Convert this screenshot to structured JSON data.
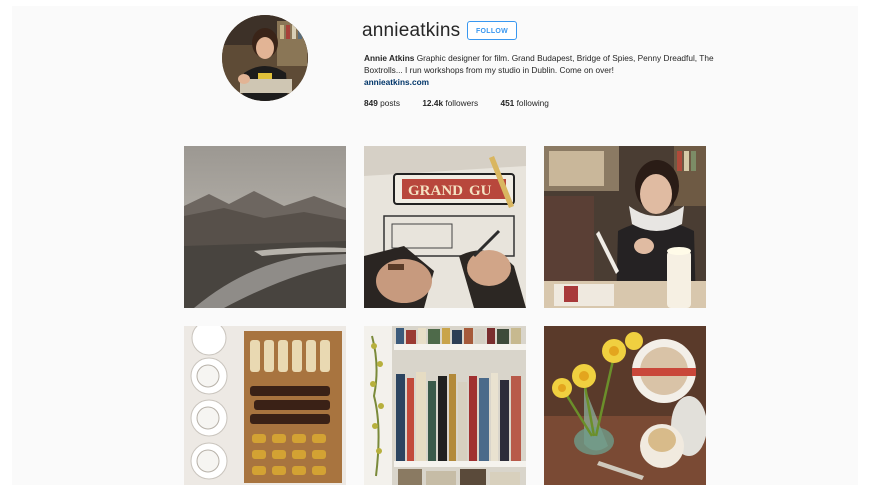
{
  "profile": {
    "username": "annieatkins",
    "follow_label": "FOLLOW",
    "bio_name": "Annie Atkins",
    "bio_text": "Graphic designer for film. Grand Budapest, Bridge of Spies, Penny Dreadful, The Boxtrolls... I run workshops from my studio in Dublin. Come on over!",
    "link": "annieatkins.com",
    "stats": {
      "posts_count": "849",
      "posts_label": "posts",
      "followers_count": "12.4k",
      "followers_label": "followers",
      "following_count": "451",
      "following_label": "following"
    }
  },
  "posts": [
    {
      "icon": "landscape-photo-icon"
    },
    {
      "icon": "sign-drawing-photo-icon"
    },
    {
      "icon": "portrait-candle-photo-icon"
    },
    {
      "icon": "teacups-chocolates-photo-icon"
    },
    {
      "icon": "bookshelf-photo-icon"
    },
    {
      "icon": "daffodils-tea-photo-icon"
    }
  ],
  "colors": {
    "follow_accent": "#3897f0",
    "link": "#003569",
    "page_bg": "#fafafa"
  }
}
